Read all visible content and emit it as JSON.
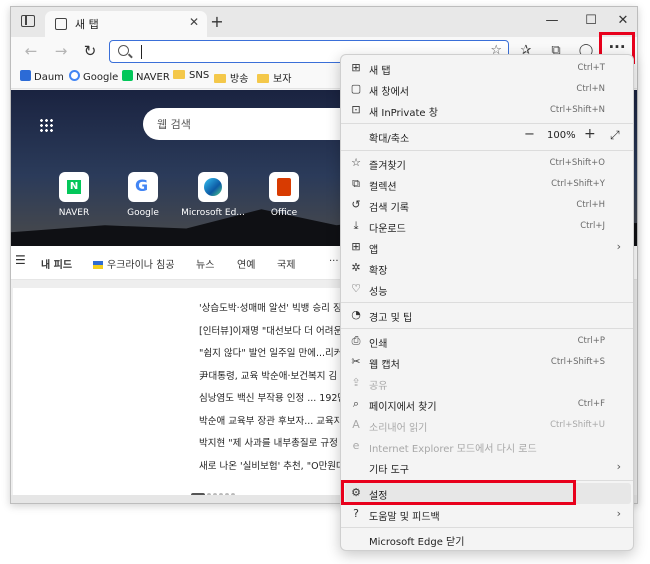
{
  "browser": {
    "tab_title": "새 탭",
    "close_glyph": "✕",
    "newtab_glyph": "+",
    "minimize_glyph": "—",
    "maximize_glyph": "☐",
    "window_close_glyph": "✕",
    "more_glyph": "···",
    "address_value": ""
  },
  "bookmarks": [
    {
      "label": "Daum",
      "icon": "daum-icon",
      "color": "#2c6bd6"
    },
    {
      "label": "Google",
      "icon": "google-icon",
      "color": "#4285f4"
    },
    {
      "label": "NAVER",
      "icon": "naver-icon",
      "color": "#03c75a"
    },
    {
      "label": "SNS",
      "icon": "folder-icon"
    },
    {
      "label": "방송",
      "icon": "folder-icon"
    },
    {
      "label": "보자",
      "icon": "folder-icon"
    }
  ],
  "newtab": {
    "search_placeholder": "웹 검색",
    "quick_links": [
      {
        "label": "NAVER",
        "icon": "naver-icon",
        "color": "#03c75a"
      },
      {
        "label": "Google",
        "icon": "google-icon",
        "color": "#4285f4"
      },
      {
        "label": "Microsoft Ed...",
        "icon": "edge-icon",
        "color": "#0c7fd0"
      },
      {
        "label": "Office",
        "icon": "office-icon",
        "color": "#d83b01"
      }
    ],
    "feed_tabs": [
      "내 피드",
      "우크라이나 침공",
      "뉴스",
      "연예",
      "국제",
      "···"
    ],
    "headlines": [
      "'상습도박·성매매 알선' 빅뱅 승리 징",
      "[인터뷰]이재명 \"대선보다 더 어려운",
      "\"쉽지 않다\" 발언 일주일 만에...리커",
      "尹대통령, 교육 박순애·보건복지 김",
      "심낭염도 백신 부작용 인정 ... 192만",
      "박순애 교육부 장관 후보자... 교육자",
      "박지현 \"제 사과를 내부총질로 규정",
      "새로 나온 '실비보험' 추천, \"O만원대"
    ]
  },
  "menu": {
    "items": [
      {
        "label": "새 탭",
        "shortcut": "Ctrl+T",
        "icon": "new-tab-icon",
        "glyph": "⊞"
      },
      {
        "label": "새 창에서",
        "shortcut": "Ctrl+N",
        "icon": "new-window-icon",
        "glyph": "▢"
      },
      {
        "label": "새 InPrivate 창",
        "shortcut": "Ctrl+Shift+N",
        "icon": "inprivate-icon",
        "glyph": "⊡"
      },
      {
        "label": "확대/축소",
        "value": "100%",
        "icon": "zoom-icon"
      },
      {
        "label": "즐겨찾기",
        "shortcut": "Ctrl+Shift+O",
        "icon": "favorites-icon",
        "glyph": "☆"
      },
      {
        "label": "컬렉션",
        "shortcut": "Ctrl+Shift+Y",
        "icon": "collections-icon",
        "glyph": "⧉"
      },
      {
        "label": "검색 기록",
        "shortcut": "Ctrl+H",
        "icon": "history-icon",
        "glyph": "↺"
      },
      {
        "label": "다운로드",
        "shortcut": "Ctrl+J",
        "icon": "download-icon",
        "glyph": "⤓"
      },
      {
        "label": "앱",
        "icon": "apps-icon",
        "glyph": "⊞",
        "chevron": "›"
      },
      {
        "label": "확장",
        "icon": "extensions-icon",
        "glyph": "✲"
      },
      {
        "label": "성능",
        "icon": "performance-icon",
        "glyph": "♡"
      },
      {
        "label": "경고 및 팁",
        "icon": "bell-icon",
        "glyph": "◔"
      },
      {
        "label": "인쇄",
        "shortcut": "Ctrl+P",
        "icon": "print-icon",
        "glyph": "⎙"
      },
      {
        "label": "웹 캡처",
        "shortcut": "Ctrl+Shift+S",
        "icon": "web-capture-icon",
        "glyph": "✂"
      },
      {
        "label": "공유",
        "icon": "share-icon",
        "glyph": "⇪"
      },
      {
        "label": "페이지에서 찾기",
        "shortcut": "Ctrl+F",
        "icon": "find-icon",
        "glyph": "⌕"
      },
      {
        "label": "소리내어 읽기",
        "shortcut": "Ctrl+Shift+U",
        "icon": "read-aloud-icon",
        "glyph": "A"
      },
      {
        "label": "Internet Explorer 모드에서 다시 로드",
        "icon": "ie-mode-icon",
        "glyph": "e"
      },
      {
        "label": "기타 도구",
        "icon": "more-tools-icon",
        "chevron": "›"
      },
      {
        "label": "설정",
        "icon": "gear-icon",
        "glyph": "⚙"
      },
      {
        "label": "도움말 및 피드백",
        "icon": "help-icon",
        "glyph": "?",
        "chevron": "›"
      },
      {
        "label": "Microsoft Edge 닫기",
        "icon": "close-edge-icon"
      }
    ],
    "zoom_minus": "−",
    "zoom_plus": "+",
    "zoom_full": "⤢"
  },
  "highlight_color": "#e8001c"
}
